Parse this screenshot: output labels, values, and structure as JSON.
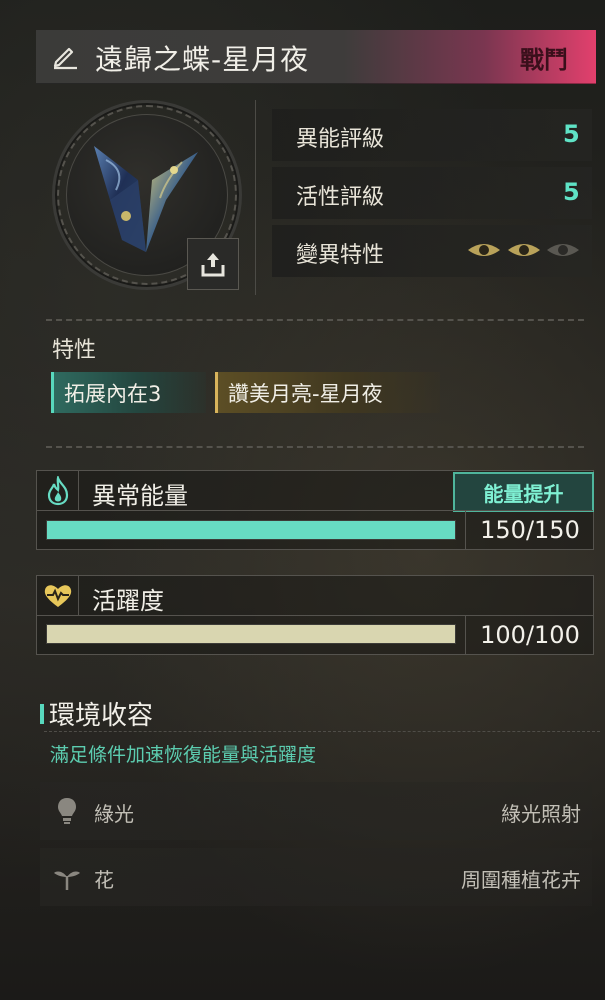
{
  "header": {
    "title": "遠歸之蝶-星月夜",
    "tag": "戰鬥",
    "edit_icon": "pencil-icon"
  },
  "portrait": {
    "image": "butterfly-starry-night",
    "upload_icon": "upload-icon"
  },
  "stats": [
    {
      "label": "異能評級",
      "value": "5"
    },
    {
      "label": "活性評級",
      "value": "5"
    },
    {
      "label": "變異特性",
      "eyes_total": 3,
      "eyes_active": 2
    }
  ],
  "traits": {
    "label": "特性",
    "items": [
      "拓展內在3",
      "讚美月亮-星月夜"
    ]
  },
  "energy": {
    "icon": "flame-icon",
    "label": "異常能量",
    "button": "能量提升",
    "value_text": "150/150",
    "current": 150,
    "max": 150,
    "color": "#67dcc3"
  },
  "vitality": {
    "icon": "heart-pulse-icon",
    "label": "活躍度",
    "value_text": "100/100",
    "current": 100,
    "max": 100,
    "color": "#d9d6b0"
  },
  "environment": {
    "title": "環境收容",
    "subtitle": "滿足條件加速恢復能量與活躍度",
    "rows": [
      {
        "icon": "lightbulb-icon",
        "label": "綠光",
        "desc": "綠光照射"
      },
      {
        "icon": "sprout-icon",
        "label": "花",
        "desc": "周圍種植花卉"
      }
    ]
  },
  "colors": {
    "accent_teal": "#58d8bd",
    "accent_gold": "#d8b45c",
    "accent_pink": "#e2406d"
  }
}
